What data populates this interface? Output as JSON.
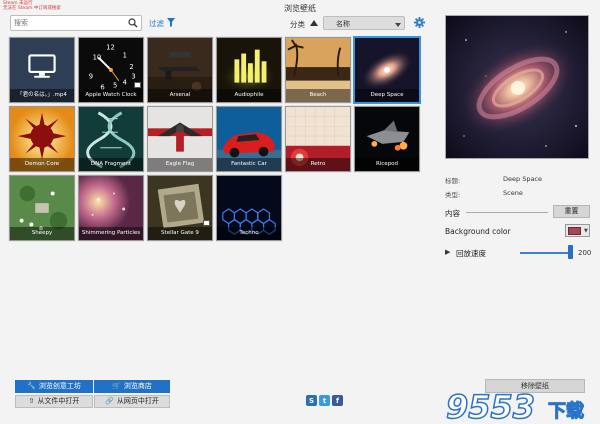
{
  "window": {
    "title": "浏览壁纸",
    "corner_note": [
      "Steam 未运行",
      "无法在 Steam 中订阅或搜索"
    ]
  },
  "toolbar": {
    "search_placeholder": "搜索",
    "filter_label": "过滤",
    "sort_label": "分类",
    "sort_value": "名称"
  },
  "tiles": [
    {
      "label": "「君の名は。」.mp4",
      "style": "monitor"
    },
    {
      "label": "Apple Watch Clock",
      "style": "clock"
    },
    {
      "label": "Arsenal",
      "style": "arsenal"
    },
    {
      "label": "Audiophile",
      "style": "audio"
    },
    {
      "label": "Beach",
      "style": "beach"
    },
    {
      "label": "Deep Space",
      "style": "space",
      "selected": true
    },
    {
      "label": "Demon Core",
      "style": "demon"
    },
    {
      "label": "DNA Fragment",
      "style": "dna"
    },
    {
      "label": "Eagle Flag",
      "style": "eagle"
    },
    {
      "label": "Fantastic Car",
      "style": "car"
    },
    {
      "label": "Retro",
      "style": "retro"
    },
    {
      "label": "Ricepod",
      "style": "ricepod"
    },
    {
      "label": "Sheepy",
      "style": "sheepy"
    },
    {
      "label": "Shimmering Particles",
      "style": "shimmer"
    },
    {
      "label": "Stellar Gate 9",
      "style": "stellar"
    },
    {
      "label": "Techno",
      "style": "techno"
    }
  ],
  "details": {
    "title_label": "标题:",
    "title_value": "Deep Space",
    "type_label": "类型:",
    "type_value": "Scene",
    "content_label": "内容",
    "reset_label": "重置",
    "bgcolor_label": "Background color",
    "bgcolor_value": "#a44758",
    "speed_label": "回放速度",
    "speed_value": "200",
    "speed_fraction": 0.93
  },
  "footer": {
    "workshop_btn": "浏览创意工坊",
    "store_btn": "浏览商店",
    "open_file_btn": "从文件中打开",
    "open_web_btn": "从网页中打开",
    "remove_btn": "移除壁纸",
    "social": [
      "steam-icon",
      "twitter-icon",
      "facebook-icon"
    ]
  },
  "watermark": {
    "text": "9553",
    "suffix": "下载"
  },
  "colors": {
    "accent": "#2171c6",
    "selection": "#3a91dc"
  }
}
